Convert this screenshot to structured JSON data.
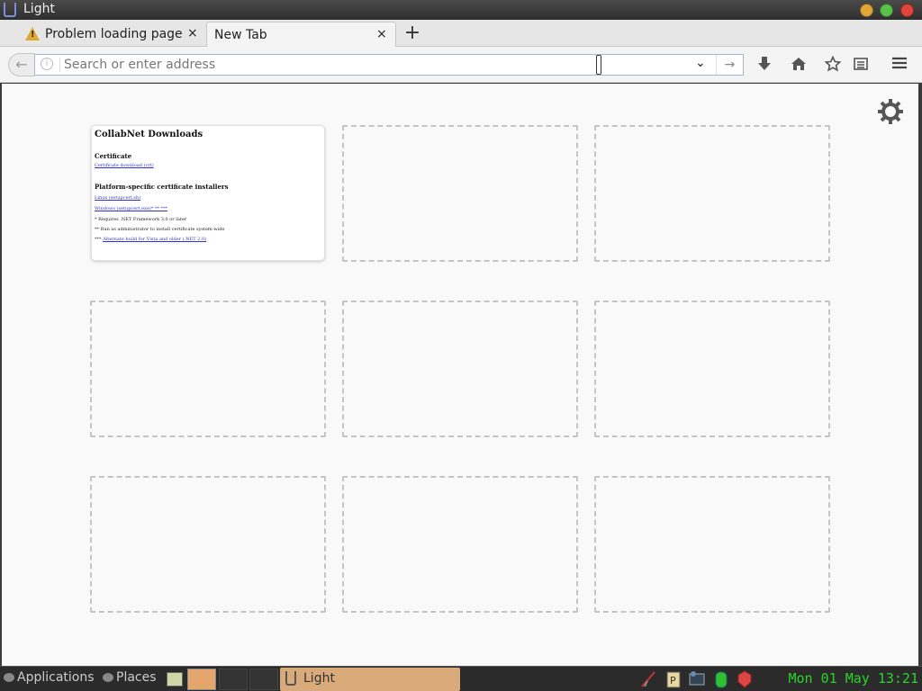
{
  "window": {
    "title": "Light"
  },
  "tabs": [
    {
      "label": "Problem loading page",
      "close": "×",
      "warning": true
    },
    {
      "label": "New Tab",
      "close": "×",
      "active": true
    }
  ],
  "new_tab_symbol": "+",
  "navbar": {
    "back_symbol": "←",
    "info_symbol": "i",
    "url_placeholder": "Search or enter address",
    "url_value": "",
    "dropdown_symbol": "⌄",
    "go_symbol": "→",
    "toolbar_icons": [
      "download-icon",
      "home-icon",
      "bookmark-star-icon",
      "reading-list-icon",
      "menu-icon"
    ]
  },
  "content": {
    "settings_icon": "gear-icon",
    "tiles": [
      {
        "filled": true,
        "title": "CollabNet Downloads",
        "section1_heading": "Certificate",
        "section1_link": "Certificate download (crt)",
        "section2_heading": "Platform-specific certificate installers",
        "link_linux": "Linux (setupcert.sh)",
        "link_windows": "Windows (setupcert.exe)* ** ***",
        "note1": "* Requires .NET Framework 3.0 or later",
        "note2": "** Run as administrator to install certificate system-wide",
        "note3_prefix": "***",
        "note3_link": "Alternate build for Vista and older (.NET 2.0)"
      },
      {
        "filled": false
      },
      {
        "filled": false
      },
      {
        "filled": false
      },
      {
        "filled": false
      },
      {
        "filled": false
      },
      {
        "filled": false
      },
      {
        "filled": false
      },
      {
        "filled": false
      }
    ]
  },
  "taskbar": {
    "applications": "Applications",
    "places": "Places",
    "window_label": "Light",
    "clock": "Mon 01 May 13:21",
    "colors": {
      "clock": "#2ad42a",
      "active_window": "#d9ab7a"
    }
  }
}
